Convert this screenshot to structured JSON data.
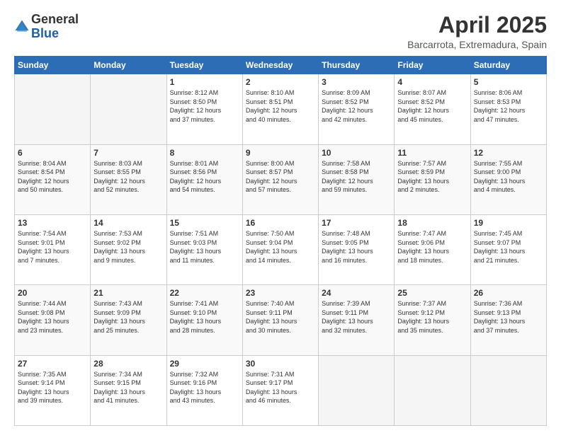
{
  "logo": {
    "general": "General",
    "blue": "Blue"
  },
  "title": "April 2025",
  "subtitle": "Barcarrota, Extremadura, Spain",
  "days_header": [
    "Sunday",
    "Monday",
    "Tuesday",
    "Wednesday",
    "Thursday",
    "Friday",
    "Saturday"
  ],
  "weeks": [
    [
      {
        "day": "",
        "info": ""
      },
      {
        "day": "",
        "info": ""
      },
      {
        "day": "1",
        "info": "Sunrise: 8:12 AM\nSunset: 8:50 PM\nDaylight: 12 hours\nand 37 minutes."
      },
      {
        "day": "2",
        "info": "Sunrise: 8:10 AM\nSunset: 8:51 PM\nDaylight: 12 hours\nand 40 minutes."
      },
      {
        "day": "3",
        "info": "Sunrise: 8:09 AM\nSunset: 8:52 PM\nDaylight: 12 hours\nand 42 minutes."
      },
      {
        "day": "4",
        "info": "Sunrise: 8:07 AM\nSunset: 8:52 PM\nDaylight: 12 hours\nand 45 minutes."
      },
      {
        "day": "5",
        "info": "Sunrise: 8:06 AM\nSunset: 8:53 PM\nDaylight: 12 hours\nand 47 minutes."
      }
    ],
    [
      {
        "day": "6",
        "info": "Sunrise: 8:04 AM\nSunset: 8:54 PM\nDaylight: 12 hours\nand 50 minutes."
      },
      {
        "day": "7",
        "info": "Sunrise: 8:03 AM\nSunset: 8:55 PM\nDaylight: 12 hours\nand 52 minutes."
      },
      {
        "day": "8",
        "info": "Sunrise: 8:01 AM\nSunset: 8:56 PM\nDaylight: 12 hours\nand 54 minutes."
      },
      {
        "day": "9",
        "info": "Sunrise: 8:00 AM\nSunset: 8:57 PM\nDaylight: 12 hours\nand 57 minutes."
      },
      {
        "day": "10",
        "info": "Sunrise: 7:58 AM\nSunset: 8:58 PM\nDaylight: 12 hours\nand 59 minutes."
      },
      {
        "day": "11",
        "info": "Sunrise: 7:57 AM\nSunset: 8:59 PM\nDaylight: 13 hours\nand 2 minutes."
      },
      {
        "day": "12",
        "info": "Sunrise: 7:55 AM\nSunset: 9:00 PM\nDaylight: 13 hours\nand 4 minutes."
      }
    ],
    [
      {
        "day": "13",
        "info": "Sunrise: 7:54 AM\nSunset: 9:01 PM\nDaylight: 13 hours\nand 7 minutes."
      },
      {
        "day": "14",
        "info": "Sunrise: 7:53 AM\nSunset: 9:02 PM\nDaylight: 13 hours\nand 9 minutes."
      },
      {
        "day": "15",
        "info": "Sunrise: 7:51 AM\nSunset: 9:03 PM\nDaylight: 13 hours\nand 11 minutes."
      },
      {
        "day": "16",
        "info": "Sunrise: 7:50 AM\nSunset: 9:04 PM\nDaylight: 13 hours\nand 14 minutes."
      },
      {
        "day": "17",
        "info": "Sunrise: 7:48 AM\nSunset: 9:05 PM\nDaylight: 13 hours\nand 16 minutes."
      },
      {
        "day": "18",
        "info": "Sunrise: 7:47 AM\nSunset: 9:06 PM\nDaylight: 13 hours\nand 18 minutes."
      },
      {
        "day": "19",
        "info": "Sunrise: 7:45 AM\nSunset: 9:07 PM\nDaylight: 13 hours\nand 21 minutes."
      }
    ],
    [
      {
        "day": "20",
        "info": "Sunrise: 7:44 AM\nSunset: 9:08 PM\nDaylight: 13 hours\nand 23 minutes."
      },
      {
        "day": "21",
        "info": "Sunrise: 7:43 AM\nSunset: 9:09 PM\nDaylight: 13 hours\nand 25 minutes."
      },
      {
        "day": "22",
        "info": "Sunrise: 7:41 AM\nSunset: 9:10 PM\nDaylight: 13 hours\nand 28 minutes."
      },
      {
        "day": "23",
        "info": "Sunrise: 7:40 AM\nSunset: 9:11 PM\nDaylight: 13 hours\nand 30 minutes."
      },
      {
        "day": "24",
        "info": "Sunrise: 7:39 AM\nSunset: 9:11 PM\nDaylight: 13 hours\nand 32 minutes."
      },
      {
        "day": "25",
        "info": "Sunrise: 7:37 AM\nSunset: 9:12 PM\nDaylight: 13 hours\nand 35 minutes."
      },
      {
        "day": "26",
        "info": "Sunrise: 7:36 AM\nSunset: 9:13 PM\nDaylight: 13 hours\nand 37 minutes."
      }
    ],
    [
      {
        "day": "27",
        "info": "Sunrise: 7:35 AM\nSunset: 9:14 PM\nDaylight: 13 hours\nand 39 minutes."
      },
      {
        "day": "28",
        "info": "Sunrise: 7:34 AM\nSunset: 9:15 PM\nDaylight: 13 hours\nand 41 minutes."
      },
      {
        "day": "29",
        "info": "Sunrise: 7:32 AM\nSunset: 9:16 PM\nDaylight: 13 hours\nand 43 minutes."
      },
      {
        "day": "30",
        "info": "Sunrise: 7:31 AM\nSunset: 9:17 PM\nDaylight: 13 hours\nand 46 minutes."
      },
      {
        "day": "",
        "info": ""
      },
      {
        "day": "",
        "info": ""
      },
      {
        "day": "",
        "info": ""
      }
    ]
  ]
}
